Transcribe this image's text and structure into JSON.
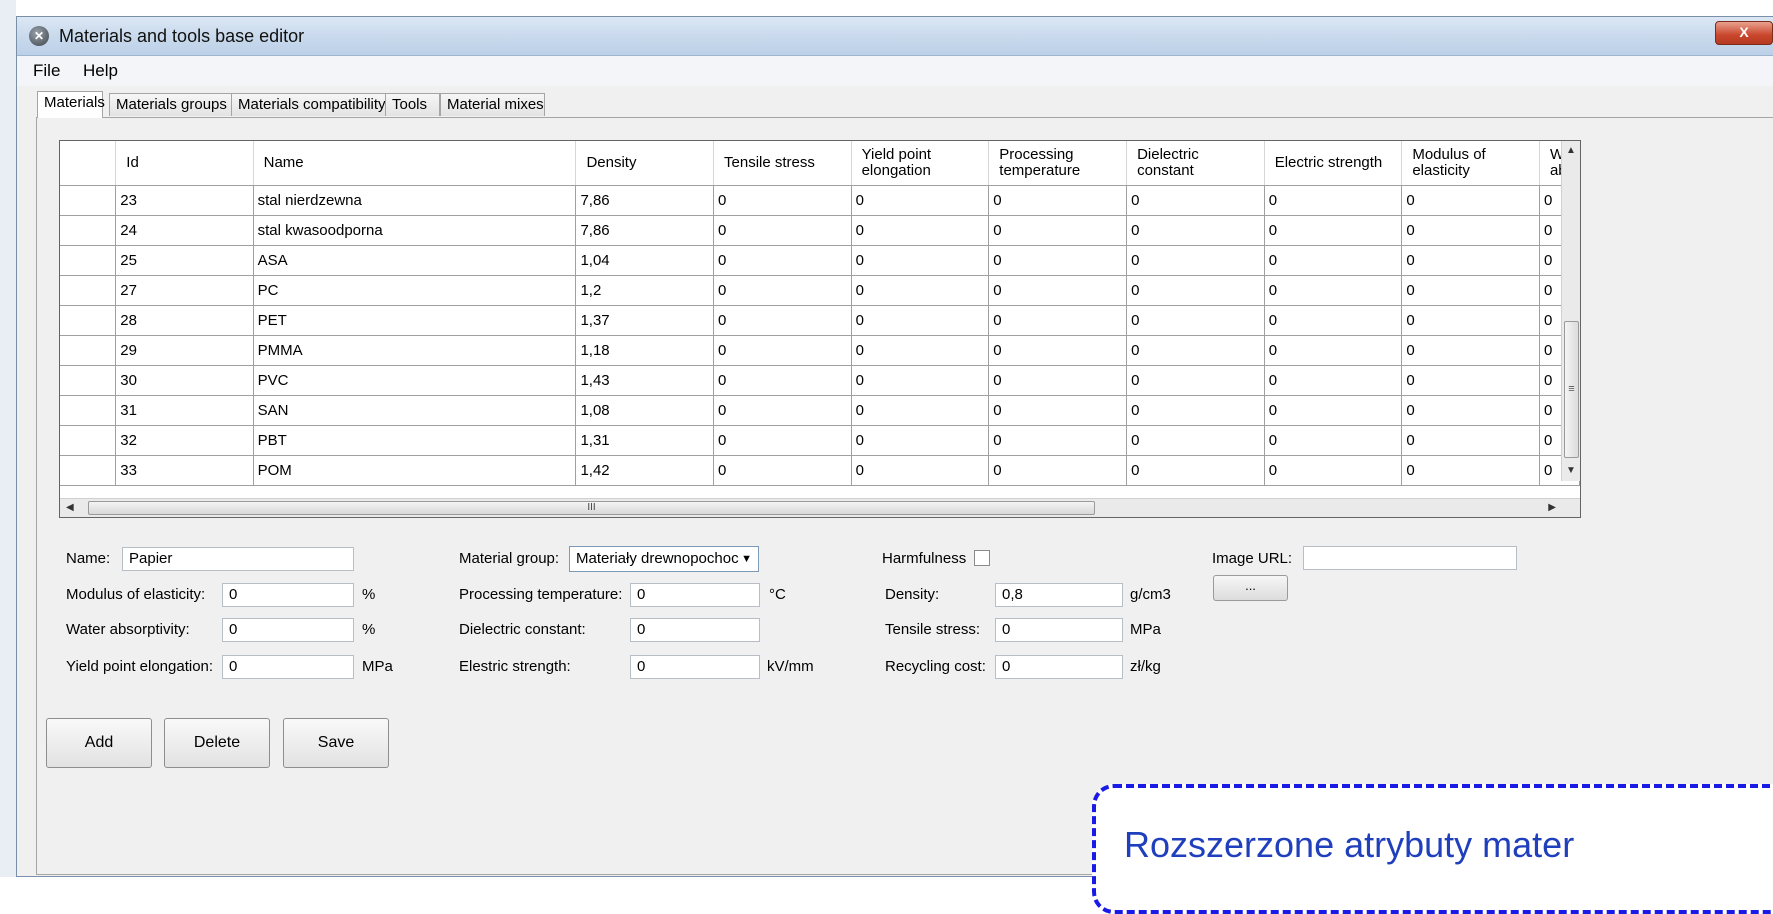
{
  "window": {
    "title": "Materials and tools base editor",
    "close_label": "X"
  },
  "menu": [
    "File",
    "Help"
  ],
  "tabs": [
    "Materials",
    "Materials groups",
    "Materials compatibility",
    "Tools",
    "Material mixes"
  ],
  "grid": {
    "columns": [
      "Id",
      "Name",
      "Density",
      "Tensile stress",
      "Yield point elongation",
      "Processing temperature",
      "Dielectric constant",
      "Electric strength",
      "Modulus of elasticity",
      "W ab"
    ],
    "rows": [
      [
        "23",
        "stal nierdzewna",
        "7,86",
        "0",
        "0",
        "0",
        "0",
        "0",
        "0",
        "0"
      ],
      [
        "24",
        "stal kwasoodporna",
        "7,86",
        "0",
        "0",
        "0",
        "0",
        "0",
        "0",
        "0"
      ],
      [
        "25",
        "ASA",
        "1,04",
        "0",
        "0",
        "0",
        "0",
        "0",
        "0",
        "0"
      ],
      [
        "27",
        "PC",
        "1,2",
        "0",
        "0",
        "0",
        "0",
        "0",
        "0",
        "0"
      ],
      [
        "28",
        "PET",
        "1,37",
        "0",
        "0",
        "0",
        "0",
        "0",
        "0",
        "0"
      ],
      [
        "29",
        "PMMA",
        "1,18",
        "0",
        "0",
        "0",
        "0",
        "0",
        "0",
        "0"
      ],
      [
        "30",
        "PVC",
        "1,43",
        "0",
        "0",
        "0",
        "0",
        "0",
        "0",
        "0"
      ],
      [
        "31",
        "SAN",
        "1,08",
        "0",
        "0",
        "0",
        "0",
        "0",
        "0",
        "0"
      ],
      [
        "32",
        "PBT",
        "1,31",
        "0",
        "0",
        "0",
        "0",
        "0",
        "0",
        "0"
      ],
      [
        "33",
        "POM",
        "1,42",
        "0",
        "0",
        "0",
        "0",
        "0",
        "0",
        "0"
      ]
    ],
    "hscroll_mark": "III",
    "vscroll_mark": "≡"
  },
  "form": {
    "name": {
      "label": "Name:",
      "value": "Papier"
    },
    "modulus": {
      "label": "Modulus of elasticity:",
      "value": "0",
      "unit": "%"
    },
    "water": {
      "label": "Water absorptivity:",
      "value": "0",
      "unit": "%"
    },
    "yield": {
      "label": "Yield point elongation:",
      "value": "0",
      "unit": "MPa"
    },
    "group": {
      "label": "Material group:",
      "value": "Materiały drewnopochoc"
    },
    "processing": {
      "label": "Processing temperature:",
      "value": "0",
      "unit": "°C"
    },
    "dielectric": {
      "label": "Dielectric constant:",
      "value": "0"
    },
    "electric": {
      "label": "Elestric strength:",
      "value": "0",
      "unit": "kV/mm"
    },
    "harmfulness": {
      "label": "Harmfulness",
      "checked": false
    },
    "density": {
      "label": "Density:",
      "value": "0,8",
      "unit": "g/cm3"
    },
    "tensile": {
      "label": "Tensile stress:",
      "value": "0",
      "unit": "MPa"
    },
    "recycling": {
      "label": "Recycling cost:",
      "value": "0",
      "unit": "zł/kg"
    },
    "image": {
      "label": "Image URL:",
      "value": "",
      "browse_label": "..."
    }
  },
  "buttons": {
    "add": "Add",
    "delete": "Delete",
    "save": "Save"
  },
  "callout": {
    "text": "Rozszerzone atrybuty mater"
  }
}
